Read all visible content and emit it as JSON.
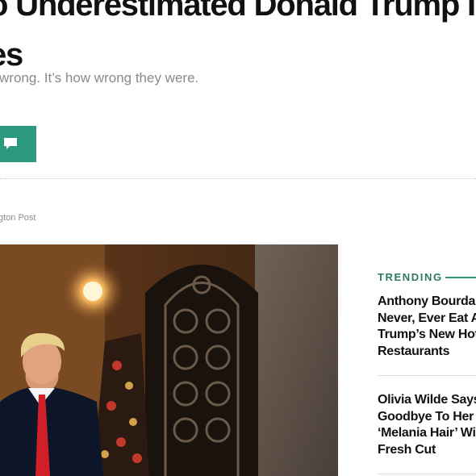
{
  "article": {
    "headline_line1": "o Underestimated Donald Trump In M",
    "headline_line2": "es",
    "subhead": "wrong. It’s how wrong they were.",
    "byline_source": "gton Post"
  },
  "actions": {
    "comment_icon": "comment-icon"
  },
  "trending": {
    "label": "TRENDING",
    "items": [
      {
        "title_lines": [
          "Anthony Bourdai",
          "Never, Ever Eat A",
          "Trump’s New Hot",
          "Restaurants"
        ]
      },
      {
        "title_lines": [
          "Olivia Wilde Says",
          "Goodbye To Her",
          "‘Melania Hair’ Wi",
          "Fresh Cut"
        ]
      }
    ]
  },
  "colors": {
    "accent_green": "#2c9a7e",
    "trending_label": "#2c7a66",
    "headline": "#111111",
    "muted_text": "#8a8a8a"
  }
}
